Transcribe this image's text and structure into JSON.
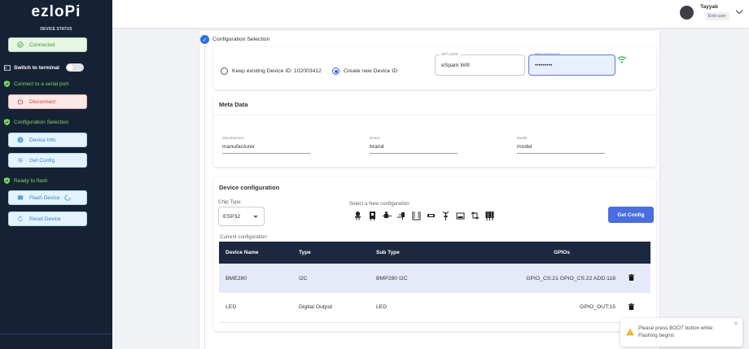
{
  "sidebar": {
    "logo": "ezloPi",
    "device_status_heading": "DEVICE STATUS",
    "connected_label": "Connected",
    "switch_terminal_label": "Switch to terminal",
    "connect_serial_label": "Connect to a serial port",
    "disconnect_label": "Disconnect",
    "config_selection_label": "Configuration Selection",
    "device_info_label": "Device Info",
    "get_config_label": "Get Config",
    "ready_flash_label": "Ready to flash",
    "flash_device_label": "Flash Device",
    "reset_device_label": "Reset Device"
  },
  "header": {
    "user_name": "Tayyab",
    "user_role": "End-user"
  },
  "config_selection": {
    "heading": "Configuration Selection",
    "keep_existing_label": "Keep existing Device ID: 102003412",
    "create_new_label": "Create new Device ID",
    "wifi_ssid_label": "WiFi SSID",
    "wifi_ssid_value": "eSpark Wifi",
    "wifi_password_label": "WiFi Password",
    "wifi_password_value": "•••••••••"
  },
  "meta_data": {
    "title": "Meta Data",
    "manufacturer_label": "Manufacturer",
    "manufacturer_value": "manufacturer",
    "brand_label": "Brand",
    "brand_value": "brand",
    "model_label": "Model",
    "model_value": "model"
  },
  "device_configuration": {
    "title": "Device configuration",
    "chip_type_label": "Chip Type",
    "chip_type_value": "ESP32",
    "select_new_label": "Select a New configuration",
    "get_config_button": "Get Config",
    "current_config_label": "Current configuration",
    "columns": [
      "Device Name",
      "Type",
      "Sub Type",
      "GPIOs"
    ],
    "rows": [
      {
        "name": "BME280",
        "type": "I2C",
        "sub_type": "BMP280 I2C",
        "gpios": "GPIO_CS:21 GPIO_CS:22 ADD:118"
      },
      {
        "name": "LED",
        "type": "Digital Output",
        "sub_type": "LED",
        "gpios": "GPIO_OUT:15"
      }
    ]
  },
  "toast": {
    "message": "Please press BOOT button while Flashing begins"
  }
}
